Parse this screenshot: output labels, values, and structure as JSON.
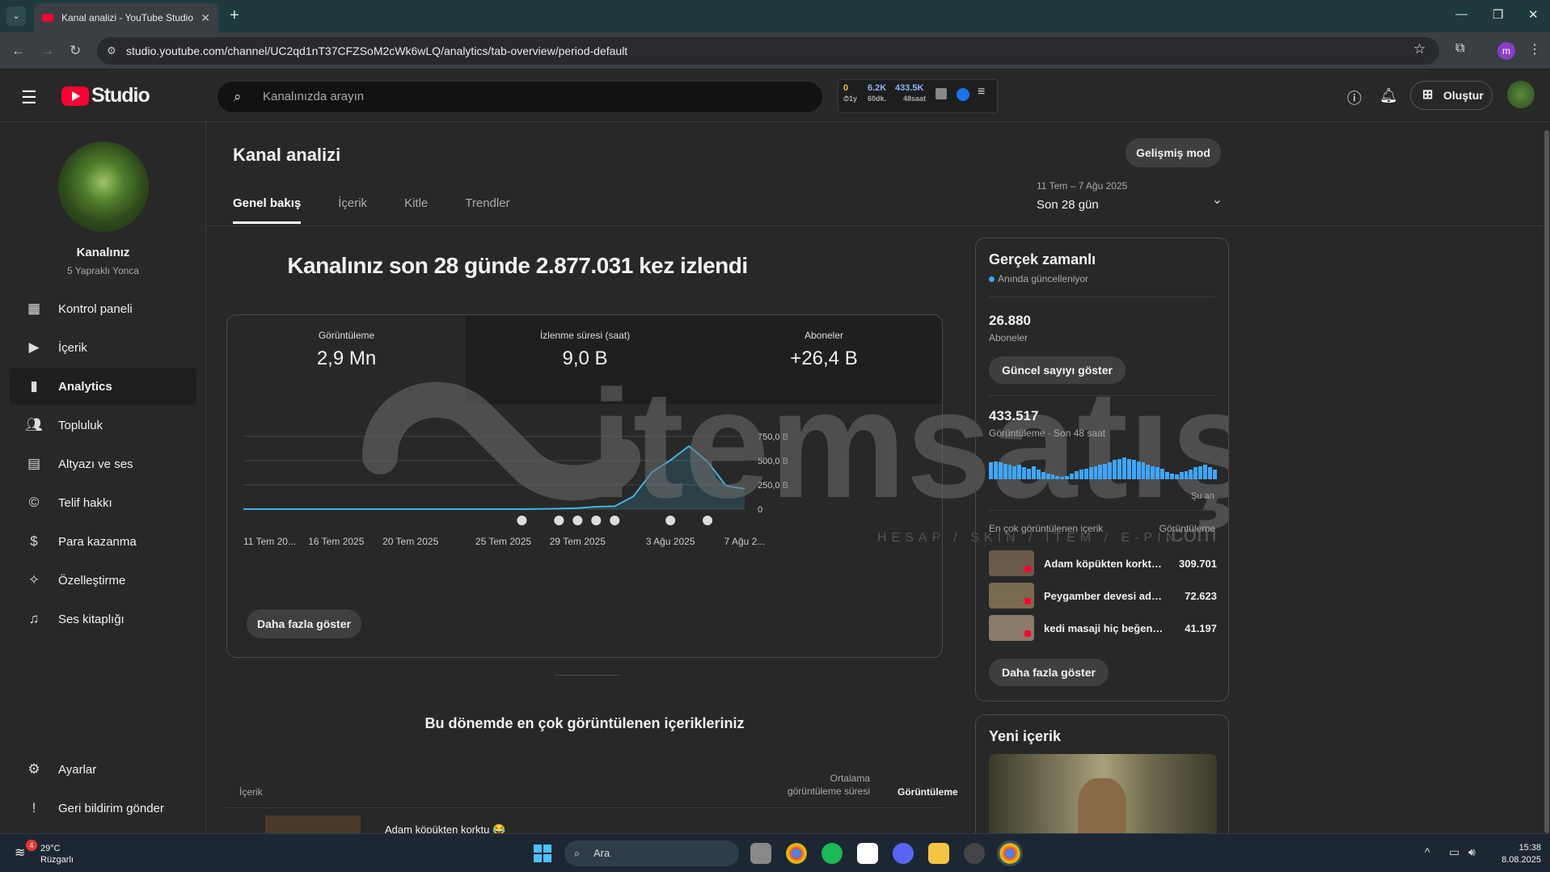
{
  "browser": {
    "tab_title": "Kanal analizi - YouTube Studio",
    "url": "studio.youtube.com/channel/UC2qd1nT37CFZSoM2cWk6wLQ/analytics/tab-overview/period-default",
    "profile_initial": "m"
  },
  "header": {
    "logo_text": "Studio",
    "search_placeholder": "Kanalınızda arayın",
    "widget": {
      "a": "0",
      "a_sub": "1y",
      "b": "6.2K",
      "b_sub": "60dk.",
      "c": "433.5K",
      "c_sub": "48saat"
    },
    "create_label": "Oluştur"
  },
  "sidebar": {
    "channel_title": "Kanalınız",
    "channel_name": "5 Yapraklı Yonca",
    "items": [
      {
        "label": "Kontrol paneli",
        "icon": "dashboard-icon"
      },
      {
        "label": "İçerik",
        "icon": "content-icon"
      },
      {
        "label": "Analytics",
        "icon": "analytics-icon",
        "active": true
      },
      {
        "label": "Topluluk",
        "icon": "community-icon"
      },
      {
        "label": "Altyazı ve ses",
        "icon": "subtitles-icon"
      },
      {
        "label": "Telif hakkı",
        "icon": "copyright-icon"
      },
      {
        "label": "Para kazanma",
        "icon": "dollar-icon"
      },
      {
        "label": "Özelleştirme",
        "icon": "wand-icon"
      },
      {
        "label": "Ses kitaplığı",
        "icon": "audio-library-icon"
      }
    ],
    "settings_label": "Ayarlar",
    "feedback_label": "Geri bildirim gönder"
  },
  "main": {
    "title": "Kanal analizi",
    "advanced_mode": "Gelişmiş mod",
    "tabs": [
      "Genel bakış",
      "İçerik",
      "Kitle",
      "Trendler"
    ],
    "period_range": "11 Tem – 7 Ağu 2025",
    "period_label": "Son 28 gün",
    "headline": "Kanalınız son 28 günde 2.877.031 kez izlendi",
    "metrics": [
      {
        "label": "Görüntüleme",
        "value": "2,9 Mn"
      },
      {
        "label": "İzlenme süresi (saat)",
        "value": "9,0 B"
      },
      {
        "label": "Aboneler",
        "value": "+26,4 B"
      }
    ],
    "show_more": "Daha fazla göster",
    "top_content_title": "Bu dönemde en çok görüntülenen içerikleriniz",
    "table": {
      "col_content": "İçerik",
      "col_avg": "Ortalama görüntüleme süresi",
      "col_views": "Görüntüleme",
      "first_row_title": "Adam köpükten korktu 😂"
    }
  },
  "chart_data": {
    "type": "line",
    "x": [
      "11 Tem 2025",
      "12 Tem 2025",
      "13 Tem 2025",
      "14 Tem 2025",
      "15 Tem 2025",
      "16 Tem 2025",
      "17 Tem 2025",
      "18 Tem 2025",
      "19 Tem 2025",
      "20 Tem 2025",
      "21 Tem 2025",
      "22 Tem 2025",
      "23 Tem 2025",
      "24 Tem 2025",
      "25 Tem 2025",
      "26 Tem 2025",
      "27 Tem 2025",
      "28 Tem 2025",
      "29 Tem 2025",
      "30 Tem 2025",
      "31 Tem 2025",
      "1 Ağu 2025",
      "2 Ağu 2025",
      "3 Ağu 2025",
      "4 Ağu 2025",
      "5 Ağu 2025",
      "6 Ağu 2025",
      "7 Ağu 2025"
    ],
    "values": [
      0,
      0,
      0,
      0,
      0,
      0,
      0,
      0,
      0,
      0,
      0,
      0,
      0,
      0,
      0,
      0,
      2000,
      5000,
      10000,
      25000,
      30000,
      130000,
      380000,
      505000,
      650000,
      490000,
      240000,
      210000
    ],
    "tick_labels": [
      "11 Tem 20...",
      "16 Tem 2025",
      "20 Tem 2025",
      "25 Tem 2025",
      "29 Tem 2025",
      "3 Ağu 2025",
      "7 Ağu 2..."
    ],
    "y_ticks": [
      "0",
      "250,0 B",
      "500,0 B",
      "750,0 B"
    ],
    "ylim": [
      0,
      750000
    ],
    "line_color": "#41b4e0",
    "grid": true,
    "markers_at": [
      "26 Tem 2025",
      "28 Tem 2025",
      "29 Tem 2025",
      "30 Tem 2025",
      "31 Tem 2025",
      "3 Ağu 2025",
      "5 Ağu 2025"
    ]
  },
  "realtime": {
    "title": "Gerçek zamanlı",
    "live_label": "Anında güncelleniyor",
    "subs_value": "26.880",
    "subs_label": "Aboneler",
    "subs_btn": "Güncel sayıyı göster",
    "views_value": "433.517",
    "views_label": "Görüntüleme · Son 48 saat",
    "now_label": "Şu an",
    "bar_levels": [
      0.7,
      0.75,
      0.7,
      0.65,
      0.6,
      0.55,
      0.6,
      0.5,
      0.45,
      0.55,
      0.4,
      0.3,
      0.25,
      0.2,
      0.15,
      0.1,
      0.15,
      0.25,
      0.35,
      0.4,
      0.45,
      0.5,
      0.55,
      0.6,
      0.65,
      0.7,
      0.8,
      0.85,
      0.9,
      0.85,
      0.8,
      0.75,
      0.7,
      0.6,
      0.55,
      0.5,
      0.45,
      0.3,
      0.25,
      0.2,
      0.3,
      0.35,
      0.4,
      0.5,
      0.55,
      0.6,
      0.5,
      0.4
    ],
    "top_label": "En çok görüntülenen içerik",
    "top_views_label": "Görüntüleme",
    "videos": [
      {
        "title": "Adam köpükten korktu...",
        "views": "309.701"
      },
      {
        "title": "Peygamber devesi ada...",
        "views": "72.623"
      },
      {
        "title": "kedi masaji hiç beğenm...",
        "views": "41.197"
      }
    ],
    "more_btn": "Daha fazla göster"
  },
  "new_content": {
    "title": "Yeni içerik"
  },
  "watermark": {
    "brand": "itemsatış",
    "tagline": "HESAP / SKIN / ITEM / E-PIN",
    "suffix": ".com"
  },
  "taskbar": {
    "weather_badge": "4",
    "temp": "29°C",
    "weather": "Rüzgarlı",
    "search": "Ara",
    "time": "15:38",
    "date": "8.08.2025"
  }
}
